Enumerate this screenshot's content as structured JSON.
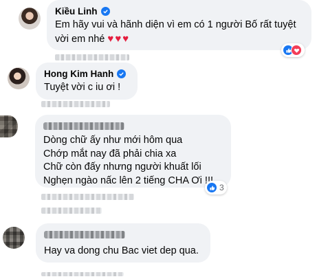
{
  "comments": [
    {
      "author": "Kiều Linh",
      "verified": true,
      "lines": [
        "Em hãy vui và hãnh diện vì em có 1 người Bố rất tuyệt",
        "vời em nhé"
      ],
      "hearts": "♥♥♥",
      "reactions": {
        "icons": [
          "like-icon",
          "love-icon"
        ],
        "count": ""
      }
    },
    {
      "author": "Hong Kim Hanh",
      "verified": true,
      "lines": [
        "Tuyệt vời c iu ơi !"
      ]
    },
    {
      "author": "",
      "verified": false,
      "lines": [
        "Dòng chữ ấy như mới hôm qua",
        "Chớp mắt nay đã phải chia xa",
        "Chữ còn đấy nhưng người khuất lối",
        "Nghẹn ngào nấc lên 2 tiếng CHA Ơi !!!"
      ],
      "reactions": {
        "icons": [
          "like-icon"
        ],
        "count": "3"
      }
    },
    {
      "author": "",
      "verified": false,
      "lines": [
        "Hay va dong chu Bac viet dep qua."
      ]
    }
  ],
  "colors": {
    "accent": "#1877f2",
    "love": "#f33e58",
    "bubble": "#f0f2f5"
  }
}
